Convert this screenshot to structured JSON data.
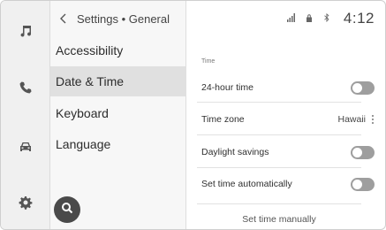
{
  "rail": {
    "items": [
      {
        "name": "music-icon"
      },
      {
        "name": "phone-icon"
      },
      {
        "name": "car-icon"
      },
      {
        "name": "gear-icon"
      }
    ]
  },
  "breadcrumb": {
    "text": "Settings • General"
  },
  "menu": {
    "items": [
      {
        "label": "Accessibility",
        "active": false
      },
      {
        "label": "Date & Time",
        "active": true
      },
      {
        "label": "Keyboard",
        "active": false
      },
      {
        "label": "Language",
        "active": false
      }
    ]
  },
  "status": {
    "time": "4:12",
    "icons": [
      "signal-icon",
      "lock-icon",
      "bluetooth-icon"
    ]
  },
  "content": {
    "section_title": "Time",
    "rows": [
      {
        "label": "24-hour time",
        "type": "toggle",
        "on": false
      },
      {
        "label": "Time zone",
        "type": "value",
        "value": "Hawaii"
      },
      {
        "label": "Daylight savings",
        "type": "toggle",
        "on": false
      },
      {
        "label": "Set time automatically",
        "type": "toggle",
        "on": false
      }
    ],
    "manual_button": "Set time manually"
  },
  "colors": {
    "rail_bg": "#f0f0f0",
    "list_bg": "#f7f7f7",
    "active_item": "#e0e0e0",
    "toggle_off": "#9e9e9e",
    "fab": "#4a4a4a"
  }
}
